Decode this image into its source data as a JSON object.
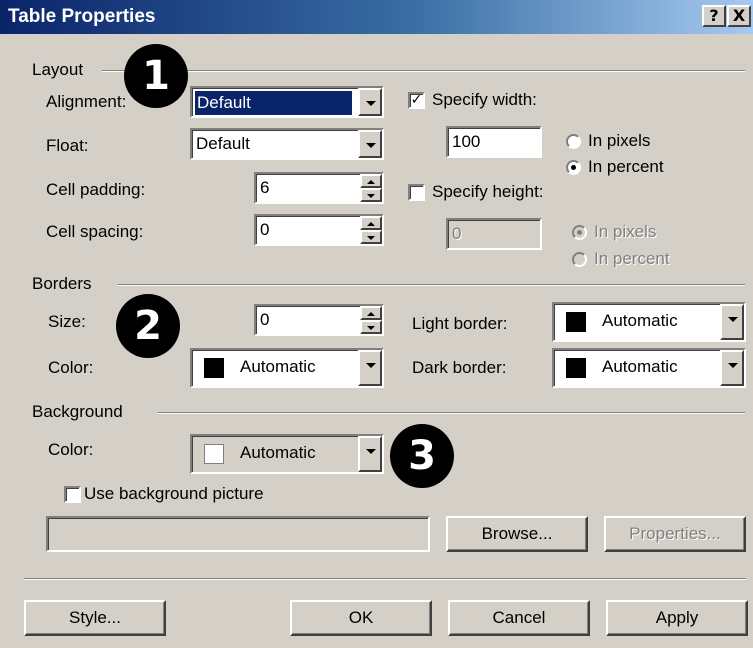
{
  "window": {
    "title": "Table Properties",
    "help_glyph": "?",
    "close_glyph": "X"
  },
  "layout": {
    "group_label": "Layout",
    "alignment": {
      "label": "Alignment:",
      "value": "Default"
    },
    "float": {
      "label": "Float:",
      "value": "Default"
    },
    "cell_padding": {
      "label": "Cell padding:",
      "value": "6"
    },
    "cell_spacing": {
      "label": "Cell spacing:",
      "value": "0"
    },
    "specify_width": {
      "label": "Specify width:",
      "checked": true,
      "value": "100"
    },
    "width_units": {
      "pixels": "In pixels",
      "percent": "In percent",
      "selected": "percent"
    },
    "specify_height": {
      "label": "Specify height:",
      "checked": false,
      "value": "0"
    },
    "height_units": {
      "pixels": "In pixels",
      "percent": "In percent",
      "selected": "pixels"
    }
  },
  "borders": {
    "group_label": "Borders",
    "size": {
      "label": "Size:",
      "value": "0"
    },
    "color": {
      "label": "Color:",
      "value": "Automatic",
      "swatch": "#000000"
    },
    "light_border": {
      "label": "Light border:",
      "value": "Automatic",
      "swatch": "#000000"
    },
    "dark_border": {
      "label": "Dark border:",
      "value": "Automatic",
      "swatch": "#000000"
    }
  },
  "background": {
    "group_label": "Background",
    "color": {
      "label": "Color:",
      "value": "Automatic",
      "swatch": "#ffffff"
    },
    "use_picture": {
      "label": "Use background picture",
      "checked": false
    },
    "picture_path": "",
    "browse_label": "Browse...",
    "properties_label": "Properties..."
  },
  "buttons": {
    "style": "Style...",
    "ok": "OK",
    "cancel": "Cancel",
    "apply": "Apply"
  },
  "callouts": [
    "1",
    "2",
    "3"
  ],
  "colors": {
    "title_start": "#0a246a",
    "title_end": "#a6caf0",
    "face": "#d4d0c8",
    "highlight": "#0a246a"
  }
}
